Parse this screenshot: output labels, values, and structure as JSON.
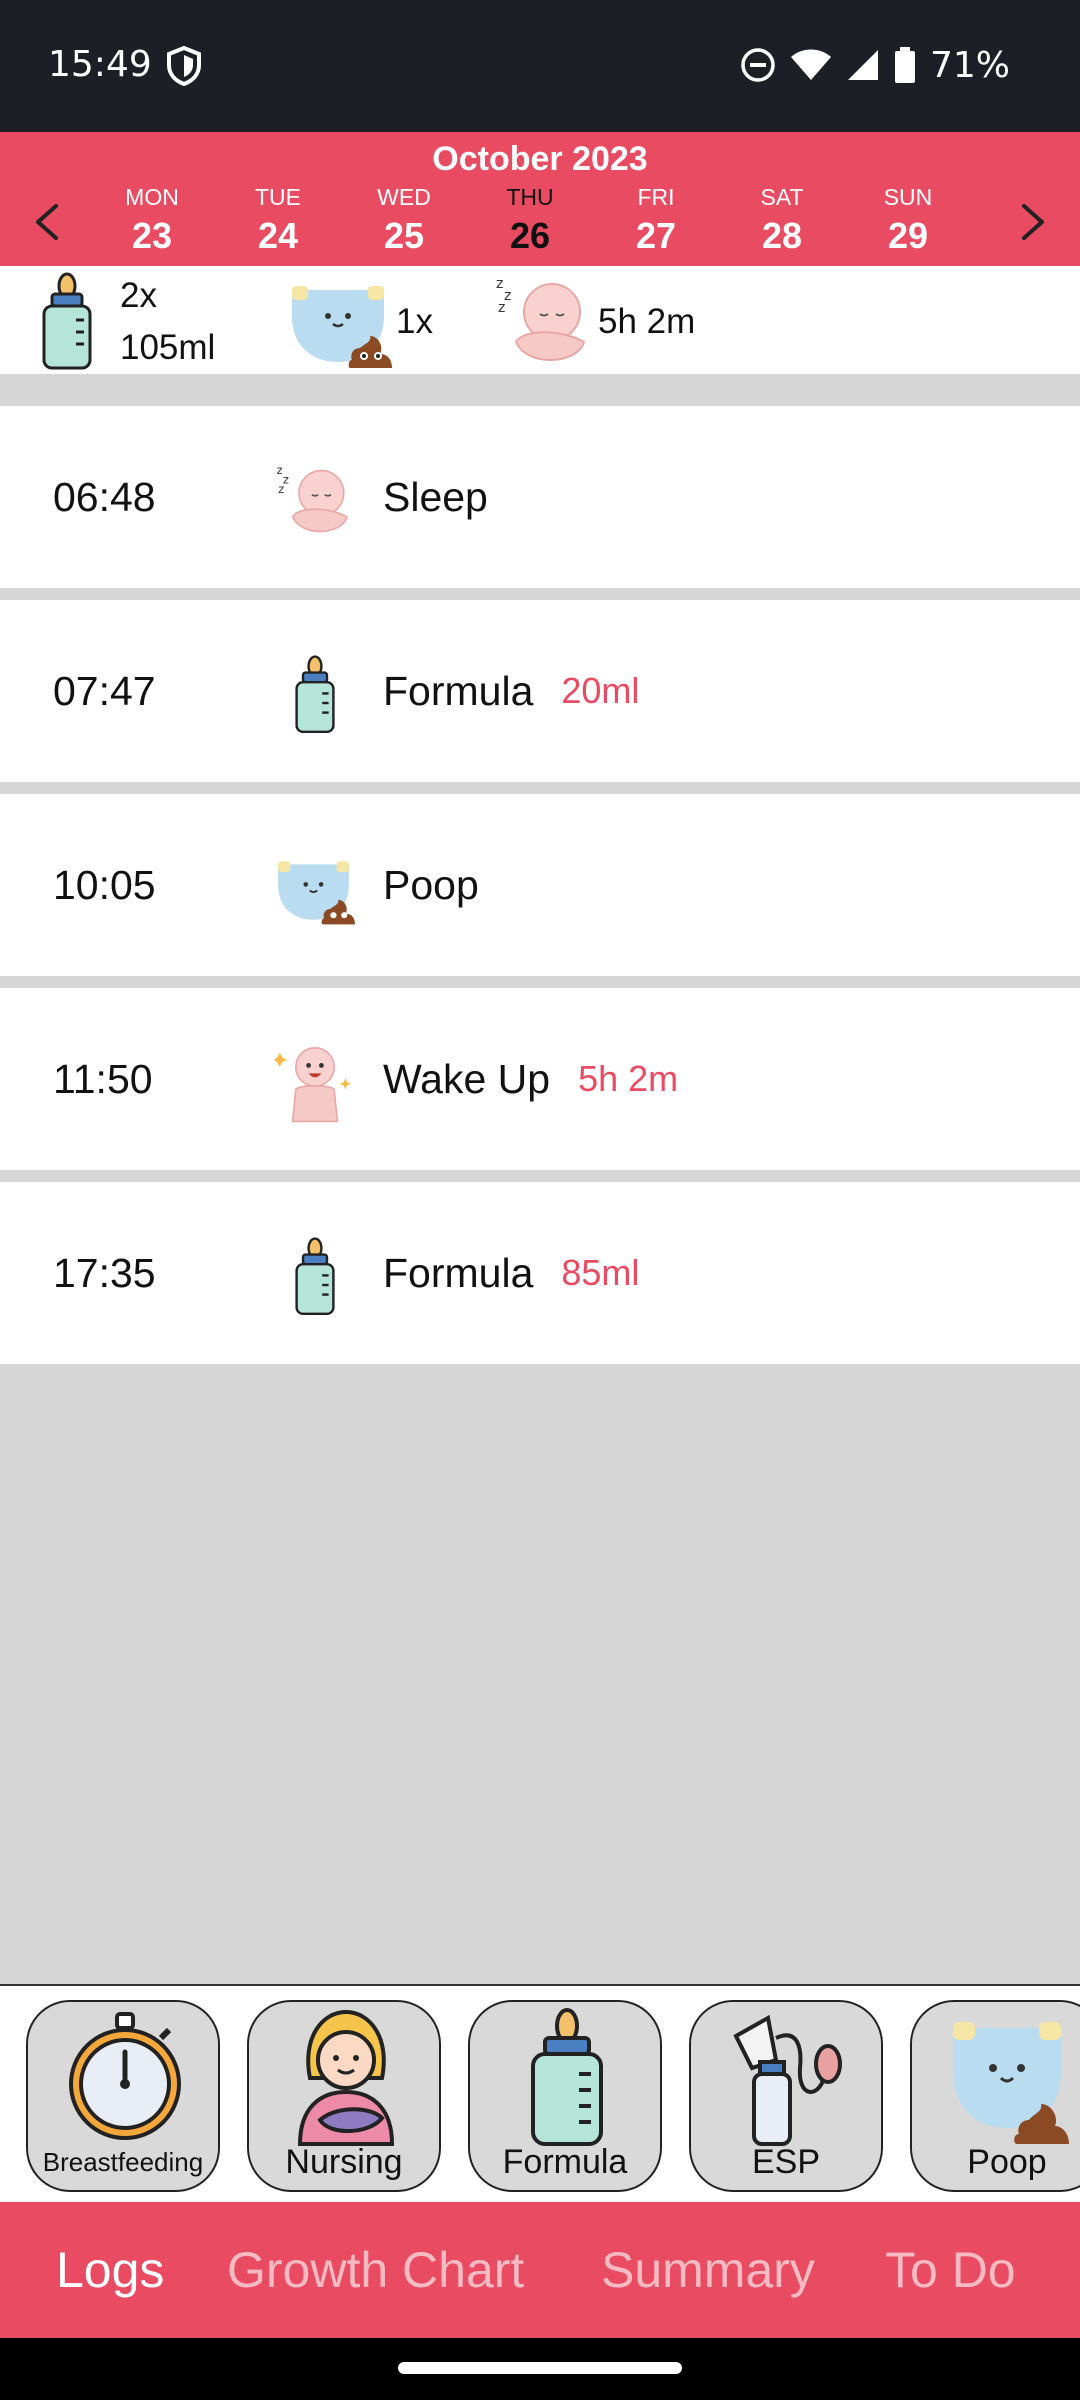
{
  "status_bar": {
    "time": "15:49",
    "battery": "71%",
    "icons": [
      "shield-icon",
      "dnd-icon",
      "wifi-icon",
      "signal-icon",
      "battery-icon"
    ]
  },
  "calendar": {
    "month": "October 2023",
    "days": [
      {
        "dow": "MON",
        "num": "23"
      },
      {
        "dow": "TUE",
        "num": "24"
      },
      {
        "dow": "WED",
        "num": "25"
      },
      {
        "dow": "THU",
        "num": "26",
        "selected": true
      },
      {
        "dow": "FRI",
        "num": "27"
      },
      {
        "dow": "SAT",
        "num": "28"
      },
      {
        "dow": "SUN",
        "num": "29"
      }
    ]
  },
  "summary": {
    "feeding_count": "2x",
    "feeding_volume": "105ml",
    "diaper_count": "1x",
    "sleep_duration": "5h 2m"
  },
  "logs": [
    {
      "time": "06:48",
      "label": "Sleep",
      "detail": "",
      "icon": "sleeping-baby-icon"
    },
    {
      "time": "07:47",
      "label": "Formula",
      "detail": "20ml",
      "icon": "bottle-icon"
    },
    {
      "time": "10:05",
      "label": "Poop",
      "detail": "",
      "icon": "diaper-poop-icon"
    },
    {
      "time": "11:50",
      "label": "Wake Up",
      "detail": "5h 2m",
      "icon": "awake-baby-icon"
    },
    {
      "time": "17:35",
      "label": "Formula",
      "detail": "85ml",
      "icon": "bottle-icon"
    }
  ],
  "quick_add": [
    {
      "label": "Breastfeeding",
      "icon": "stopwatch-icon"
    },
    {
      "label": "Nursing",
      "icon": "nursing-mother-icon"
    },
    {
      "label": "Formula",
      "icon": "bottle-icon"
    },
    {
      "label": "ESP",
      "icon": "breast-pump-icon"
    },
    {
      "label": "Poop",
      "icon": "diaper-poop-icon"
    }
  ],
  "nav_tabs": [
    {
      "label": "Logs",
      "active": true
    },
    {
      "label": "Growth Chart"
    },
    {
      "label": "Summary"
    },
    {
      "label": "To Do"
    }
  ],
  "colors": {
    "accent": "#e94b62",
    "status_bar": "#1c1f26",
    "background": "#d6d6d6"
  }
}
